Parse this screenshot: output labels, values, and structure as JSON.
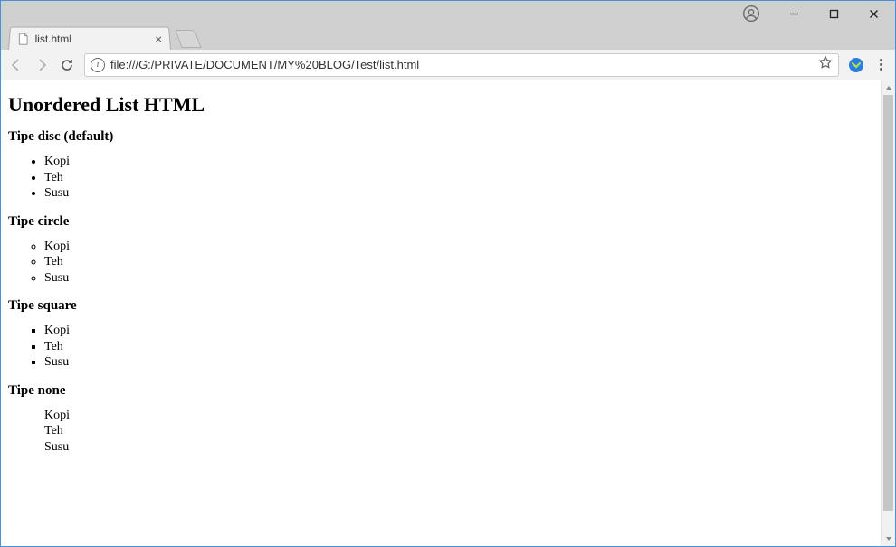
{
  "tab": {
    "title": "list.html"
  },
  "url": "file:///G:/PRIVATE/DOCUMENT/MY%20BLOG/Test/list.html",
  "page": {
    "heading": "Unordered List HTML",
    "sections": [
      {
        "title": "Tipe disc (default)",
        "style": "disc",
        "items": [
          "Kopi",
          "Teh",
          "Susu"
        ]
      },
      {
        "title": "Tipe circle",
        "style": "circle",
        "items": [
          "Kopi",
          "Teh",
          "Susu"
        ]
      },
      {
        "title": "Tipe square",
        "style": "square",
        "items": [
          "Kopi",
          "Teh",
          "Susu"
        ]
      },
      {
        "title": "Tipe none",
        "style": "none",
        "items": [
          "Kopi",
          "Teh",
          "Susu"
        ]
      }
    ]
  }
}
